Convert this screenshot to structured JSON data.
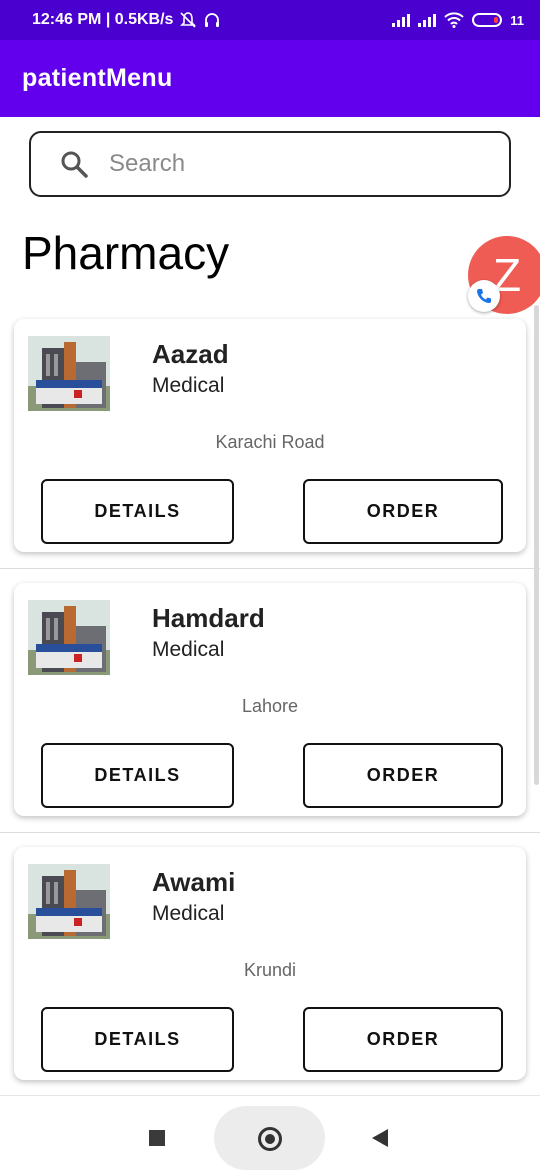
{
  "status_bar": {
    "time": "12:46 PM | 0.5KB/s",
    "battery": "11"
  },
  "app_bar": {
    "title": "patientMenu"
  },
  "search": {
    "placeholder": "Search"
  },
  "heading": "Pharmacy",
  "bubble": {
    "letter": "Z"
  },
  "pharmacies": [
    {
      "name": "Aazad",
      "type": "Medical",
      "location": "Karachi Road",
      "details_label": "DETAILS",
      "order_label": "ORDER"
    },
    {
      "name": "Hamdard",
      "type": "Medical",
      "location": "Lahore",
      "details_label": "DETAILS",
      "order_label": "ORDER"
    },
    {
      "name": "Awami",
      "type": "Medical",
      "location": "Krundi",
      "details_label": "DETAILS",
      "order_label": "ORDER"
    }
  ],
  "colors": {
    "app_bar": "#6200ee",
    "status_bar": "#4a00cf",
    "bubble": "#ef5c54"
  },
  "icons": [
    "search-icon",
    "phone-icon",
    "building-thumbnail",
    "recents-icon",
    "home-icon",
    "back-icon"
  ]
}
